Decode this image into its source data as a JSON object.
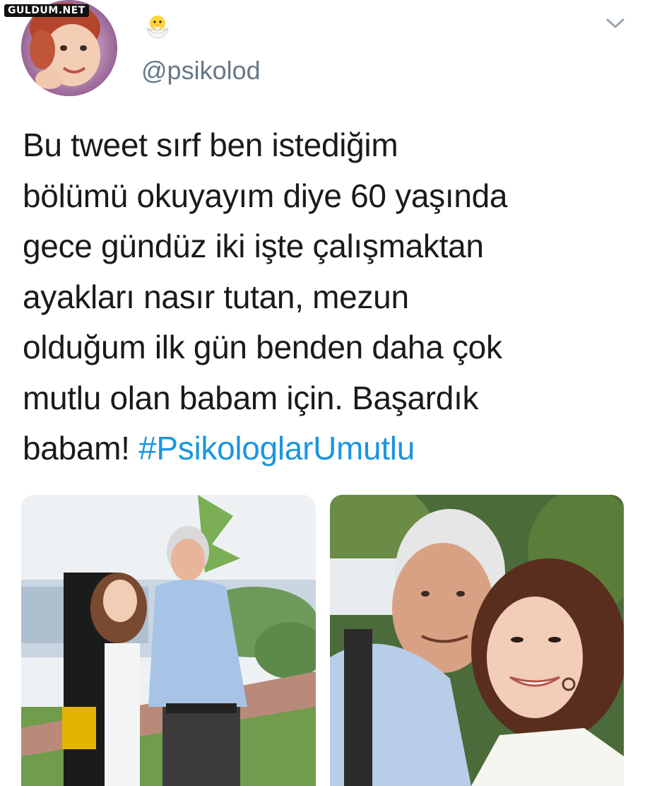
{
  "watermark": "GULDUM.NET",
  "header": {
    "handle": "@psikolod",
    "badge_icon": "baby-chick-icon",
    "menu_icon": "chevron-down-icon"
  },
  "tweet": {
    "lines": [
      "Bu tweet sırf ben istediğim",
      "bölümü okuyayım diye 60 yaşında",
      "gece gündüz iki işte çalışmaktan",
      "ayakları nasır tutan, mezun",
      "olduğum ilk gün benden daha çok",
      "mutlu olan babam için. Başardık"
    ],
    "last_line_text": "babam! ",
    "hashtag": "#PsikologlarUmutlu"
  },
  "colors": {
    "hashtag": "#1b95e0",
    "handle": "#657786",
    "text": "#1a1a1a"
  }
}
